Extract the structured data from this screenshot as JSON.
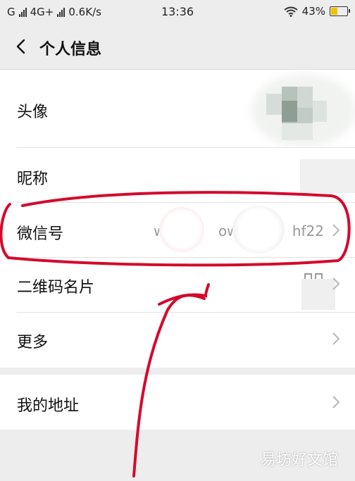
{
  "status_bar": {
    "carrier": "G",
    "network": "4G+",
    "speed": "0.6K/s",
    "time": "13:36",
    "battery": "43%",
    "battery_level": 0.43,
    "battery_color": "#f2c200"
  },
  "nav": {
    "back_icon": "chevron-left-icon",
    "title": "个人信息"
  },
  "rows": [
    {
      "label": "头像"
    },
    {
      "label": "昵称"
    },
    {
      "label": "微信号",
      "value": "wx          ow2          hf22"
    },
    {
      "label": "二维码名片"
    },
    {
      "label": "更多"
    },
    {
      "label": "我的地址"
    }
  ],
  "watermark": "易坊好文馆",
  "annotation_color": "#d40a2c"
}
